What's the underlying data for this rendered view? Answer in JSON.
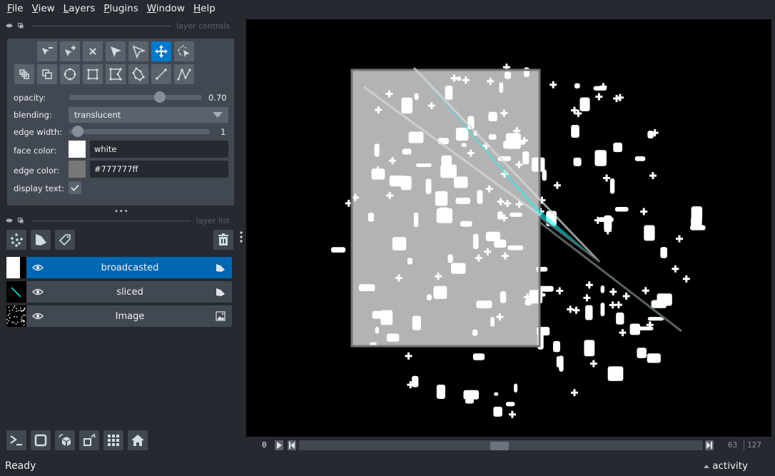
{
  "menu": [
    {
      "label": "File",
      "mnemonic": "F",
      "rest": "ile"
    },
    {
      "label": "View",
      "mnemonic": "V",
      "rest": "iew"
    },
    {
      "label": "Layers",
      "mnemonic": "L",
      "rest": "ayers"
    },
    {
      "label": "Plugins",
      "mnemonic": "P",
      "rest": "lugins"
    },
    {
      "label": "Window",
      "mnemonic": "W",
      "rest": "indow"
    },
    {
      "label": "Help",
      "mnemonic": "H",
      "rest": "elp"
    }
  ],
  "layer_controls": {
    "title": "layer controls",
    "tools_row1": [
      "remove-vertex",
      "add-vertex",
      "delete-shape",
      "select",
      "direct-select",
      "pan-zoom",
      "lasso-select"
    ],
    "tools_row2": [
      "move-back",
      "move-front",
      "add-ellipse",
      "add-rectangle",
      "add-polygon",
      "add-polygon-lasso",
      "add-line",
      "add-path"
    ],
    "active_tool": "pan-zoom",
    "opacity_label": "opacity:",
    "opacity_value": "0.70",
    "opacity": 0.7,
    "blending_label": "blending:",
    "blending_value": "translucent",
    "edge_width_label": "edge width:",
    "edge_width_value": "1",
    "edge_width_fraction": 0.0,
    "face_color_label": "face color:",
    "face_color_value": "white",
    "face_color_hex": "#ffffff",
    "edge_color_label": "edge color:",
    "edge_color_value": "#777777ff",
    "edge_color_hex": "#777777",
    "display_text_label": "display text:",
    "display_text_checked": true
  },
  "layer_list": {
    "title": "layer list",
    "layers": [
      {
        "name": "broadcasted",
        "type": "shapes",
        "visible": true,
        "selected": true
      },
      {
        "name": "sliced",
        "type": "shapes",
        "visible": true,
        "selected": false
      },
      {
        "name": "Image",
        "type": "image",
        "visible": true,
        "selected": false
      }
    ]
  },
  "dims": {
    "start": "0",
    "current": "63",
    "max": "127",
    "fraction": 0.496
  },
  "status": {
    "text": "Ready",
    "activity": "activity"
  },
  "colors": {
    "accent": "#007acc",
    "selected_layer": "#0067b3",
    "background": "#262930",
    "panel": "#414851",
    "cyan": "#00ffff"
  }
}
